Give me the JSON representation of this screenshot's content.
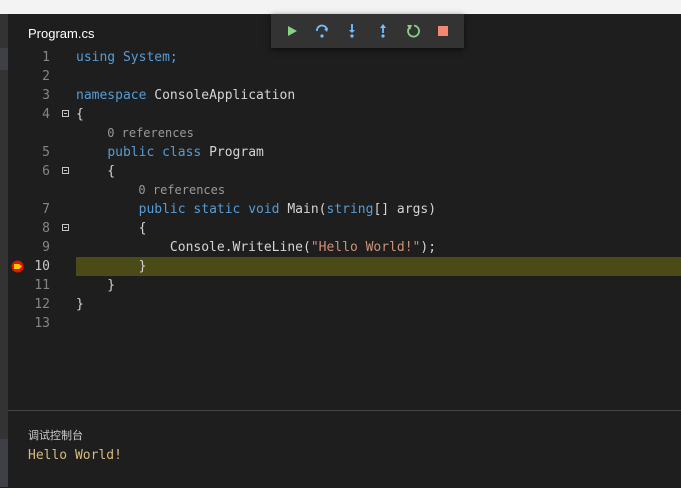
{
  "tab": {
    "filename": "Program.cs"
  },
  "debug_toolbar": {
    "buttons": [
      {
        "name": "continue-button",
        "icon": "play-icon",
        "color": "#89d185"
      },
      {
        "name": "step-over-button",
        "icon": "step-over-icon",
        "color": "#75beff"
      },
      {
        "name": "step-into-button",
        "icon": "step-into-icon",
        "color": "#75beff"
      },
      {
        "name": "step-out-button",
        "icon": "step-out-icon",
        "color": "#75beff"
      },
      {
        "name": "restart-button",
        "icon": "restart-icon",
        "color": "#89d185"
      },
      {
        "name": "stop-button",
        "icon": "stop-icon",
        "color": "#f48771"
      }
    ]
  },
  "editor": {
    "lines": [
      {
        "num": "1",
        "parts": [
          [
            "kw",
            "using System;"
          ]
        ]
      },
      {
        "num": "2",
        "parts": []
      },
      {
        "num": "3",
        "parts": [
          [
            "kw",
            "namespace "
          ],
          [
            "",
            "ConsoleApplication"
          ]
        ]
      },
      {
        "num": "4",
        "fold": true,
        "parts": [
          [
            "",
            "{"
          ]
        ]
      },
      {
        "lens": "0 references",
        "indent": 4
      },
      {
        "num": "5",
        "parts": [
          [
            "",
            "    "
          ],
          [
            "kw",
            "public class "
          ],
          [
            "",
            "Program"
          ]
        ]
      },
      {
        "num": "6",
        "fold": true,
        "parts": [
          [
            "",
            "    {"
          ]
        ]
      },
      {
        "lens": "0 references",
        "indent": 8
      },
      {
        "num": "7",
        "parts": [
          [
            "",
            "        "
          ],
          [
            "kw",
            "public static void "
          ],
          [
            "",
            "Main("
          ],
          [
            "kw",
            "string"
          ],
          [
            "",
            "[] args)"
          ]
        ]
      },
      {
        "num": "8",
        "fold": true,
        "parts": [
          [
            "",
            "        {"
          ]
        ]
      },
      {
        "num": "9",
        "parts": [
          [
            "",
            "            Console.WriteLine("
          ],
          [
            "str",
            "\"Hello World!\""
          ],
          [
            "",
            ");"
          ]
        ]
      },
      {
        "num": "10",
        "current": true,
        "breakpoint": true,
        "parts": [
          [
            "",
            "        }"
          ]
        ]
      },
      {
        "num": "11",
        "parts": [
          [
            "",
            "    }"
          ]
        ]
      },
      {
        "num": "12",
        "parts": [
          [
            "",
            "}"
          ]
        ]
      },
      {
        "num": "13",
        "parts": []
      }
    ],
    "current_line_color": "#4b4b18",
    "breakpoint_icon": "breakpoint-current-icon"
  },
  "debug_console": {
    "title": "调试控制台",
    "output": "Hello World!"
  }
}
